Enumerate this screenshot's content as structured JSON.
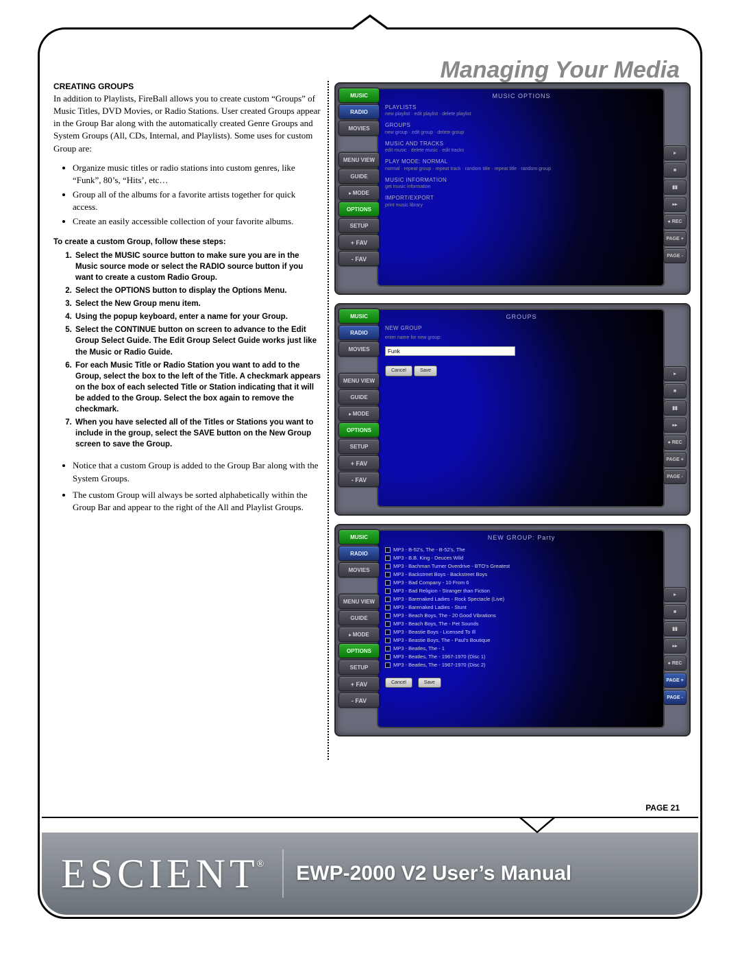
{
  "header": {
    "title": "Managing Your Media"
  },
  "section": {
    "heading": "CREATING GROUPS",
    "intro": "In addition to Playlists, FireBall allows you to create custom “Groups” of Music Titles, DVD Movies, or Radio Stations. User created Groups appear in the Group Bar along with the automatically created Genre Groups and System Groups (All, CDs, Internal, and Playlists). Some uses for custom Group are:",
    "bullets": [
      "Organize music titles or radio stations into custom genres, like “Funk”, 80’s, “Hits’, etc…",
      "Group all of the albums for a favorite artists together for quick access.",
      "Create an easily accessible collection of your favorite albums."
    ],
    "steps_intro": "To create a custom Group, follow these steps:",
    "steps": [
      "Select the MUSIC source button to make sure you are in the Music source mode or select the RADIO source button if you want to create a custom Radio Group.",
      "Select the OPTIONS button to display the Options Menu.",
      "Select the New Group menu item.",
      "Using the popup keyboard, enter a name for your Group.",
      "Select the CONTINUE button on screen to advance to the Edit Group Select Guide. The Edit Group Select Guide works just like the Music or Radio Guide.",
      "For each Music Title or Radio Station you want to add to the Group, select the box to the left of the Title. A checkmark appears on the box of each selected Title or Station indicating that it will be added to the Group. Select the box again to remove the checkmark.",
      "When you have selected all of the Titles or Stations you want to include in the group, select the SAVE button on the New Group screen to save the Group."
    ],
    "notes": [
      "Notice that a custom Group is added to the Group Bar along with the System Groups.",
      "The custom Group will always be sorted alphabetically within the Group Bar and appear to the right of the All and Playlist Groups."
    ]
  },
  "nav": {
    "music": "MUSIC",
    "radio": "RADIO",
    "movies": "MOVIES",
    "menuview": "MENU VIEW",
    "guide": "GUIDE",
    "mode": "MODE",
    "options": "OPTIONS",
    "setup": "SETUP",
    "plusfav": "+ FAV",
    "minusfav": "- FAV"
  },
  "rightbtns": {
    "b1": "▸",
    "b2": "■",
    "b3": "▮▮",
    "b4": "▸▸",
    "rec": "● REC",
    "pageplus": "PAGE +",
    "pageminus": "PAGE -"
  },
  "screen1": {
    "title": "MUSIC OPTIONS",
    "opts": [
      {
        "h": "PLAYLISTS",
        "s": "new playlist · edit playlist · delete playlist"
      },
      {
        "h": "GROUPS",
        "s": "new group · edit group · delete group"
      },
      {
        "h": "MUSIC AND TRACKS",
        "s": "edit music · delete music · edit tracks"
      },
      {
        "h": "PLAY MODE: NORMAL",
        "s": "normal · repeat group · repeat track · random title · repeat title · random group"
      },
      {
        "h": "MUSIC INFORMATION",
        "s": "get music information"
      },
      {
        "h": "IMPORT/EXPORT",
        "s": "print music library"
      }
    ]
  },
  "screen2": {
    "title": "GROUPS",
    "heading": "NEW GROUP",
    "prompt": "enter name for new group:",
    "value": "Funk",
    "cancel": "Cancel",
    "save": "Save"
  },
  "screen3": {
    "title": "NEW GROUP: Party",
    "rows": [
      "MP3 - B-52's, The - B-52's, The",
      "MP3 - B.B. King - Deuces Wild",
      "MP3 - Bachman Turner Overdrive - BTO's Greatest",
      "MP3 - Backstreet Boys - Backstreet Boys",
      "MP3 - Bad Company - 10 From 6",
      "MP3 - Bad Religion - Stranger than Fiction",
      "MP3 - Barenaked Ladies - Rock Spectacle (Live)",
      "MP3 - Barenaked Ladies - Stunt",
      "MP3 - Beach Boys, The - 20 Good Vibrations",
      "MP3 - Beach Boys, The - Pet Sounds",
      "MP3 - Beastie Boys - Licensed To Ill",
      "MP3 - Beastie Boys, The - Paul's Boutique",
      "MP3 - Beatles, The - 1",
      "MP3 - Beatles, The - 1967-1970 (Disc 1)",
      "MP3 - Beatles, The - 1967-1970 (Disc 2)"
    ],
    "cancel": "Cancel",
    "save": "Save"
  },
  "footer": {
    "page": "PAGE 21",
    "brand": "ESCIENT",
    "title": "EWP-2000 V2 User’s Manual"
  }
}
